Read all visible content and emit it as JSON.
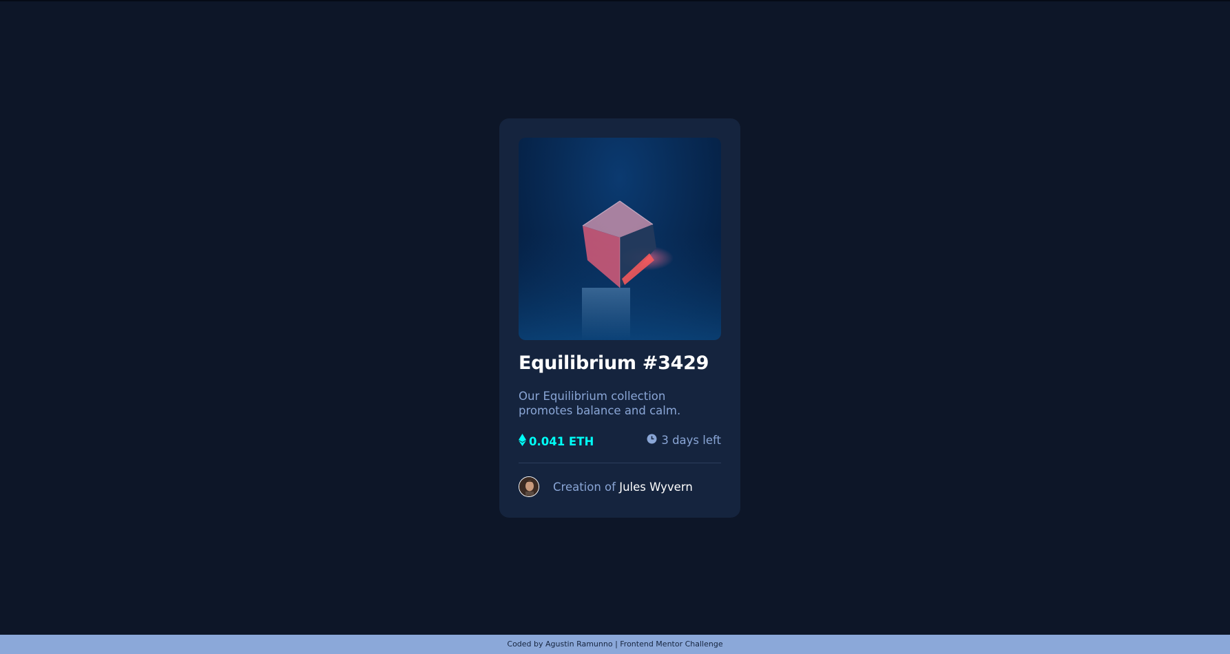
{
  "card": {
    "title": "Equilibrium #3429",
    "description": "Our Equilibrium collection promotes balance and calm.",
    "price": "0.041 ETH",
    "time_left": "3 days left",
    "creator_prefix": "Creation of",
    "creator_name": "Jules Wyvern"
  },
  "footer": {
    "text": "Coded by Agustin Ramunno | Frontend Mentor Challenge"
  },
  "icons": {
    "price": "ethereum-icon",
    "time": "clock-icon"
  },
  "colors": {
    "background": "#0d1628",
    "card": "#15243e",
    "accent": "#00fff7",
    "muted_text": "#8aa6d6",
    "footer_bg": "#8ba8d9"
  }
}
